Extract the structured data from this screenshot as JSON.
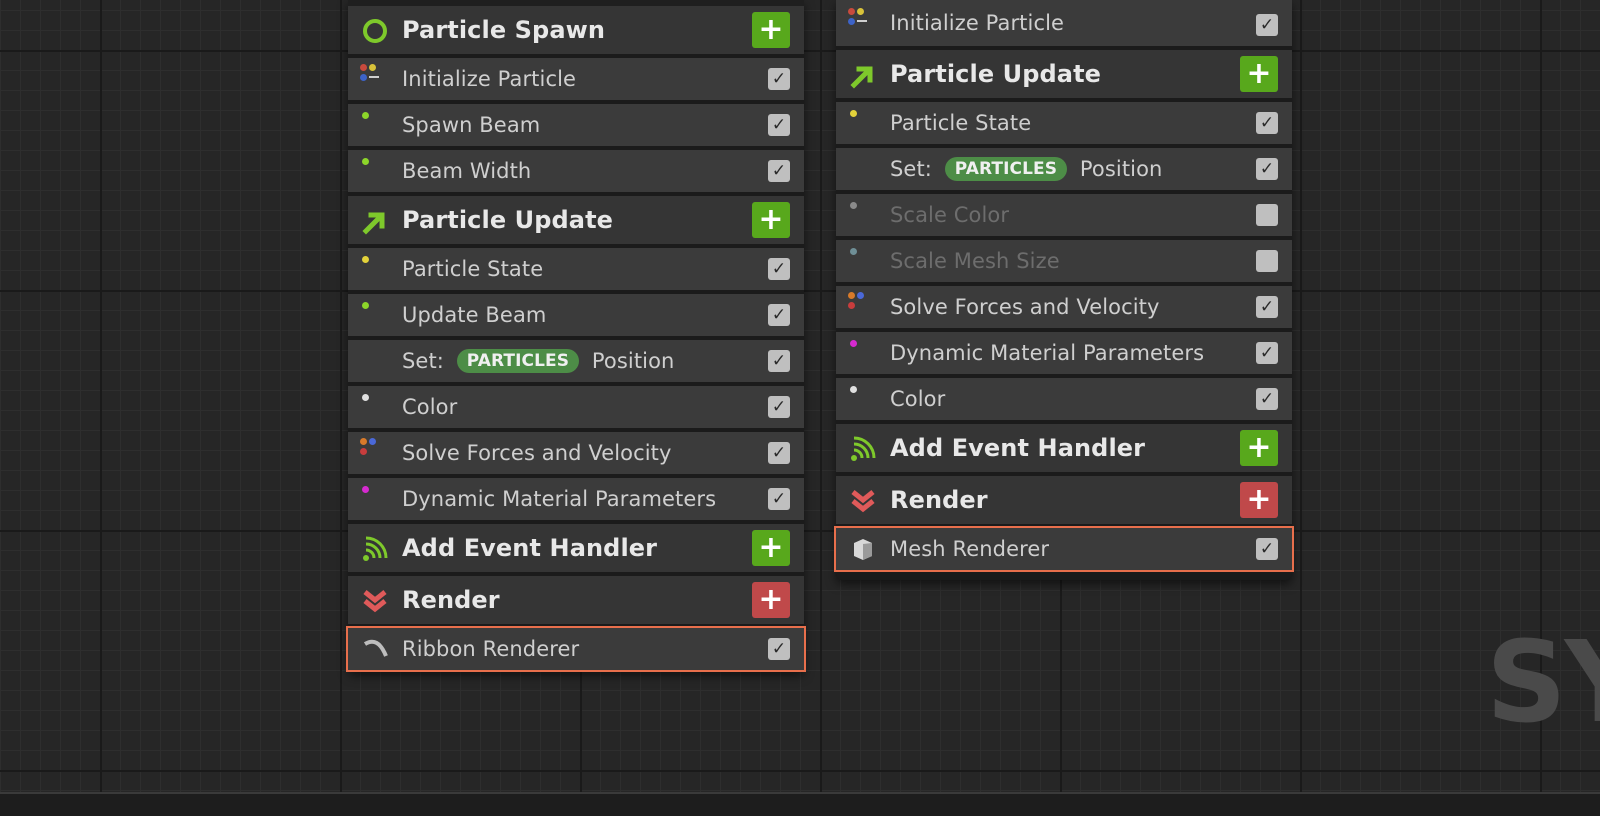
{
  "left_stack": {
    "spawn_header": "Particle Spawn",
    "spawn_items": [
      "Initialize Particle",
      "Spawn Beam",
      "Beam Width"
    ],
    "update_header": "Particle Update",
    "update_items": [
      "Particle State",
      "Update Beam",
      "Color",
      "Solve Forces and Velocity",
      "Dynamic Material Parameters"
    ],
    "set_prefix": "Set:",
    "set_pill": "PARTICLES",
    "set_suffix": "Position",
    "event_header": "Add Event Handler",
    "render_header": "Render",
    "renderer": "Ribbon Renderer"
  },
  "right_stack": {
    "init_item": "Initialize Particle",
    "update_header": "Particle Update",
    "items": [
      "Particle State",
      "Scale Color",
      "Scale Mesh Size",
      "Solve Forces and Velocity",
      "Dynamic Material Parameters",
      "Color"
    ],
    "set_prefix": "Set:",
    "set_pill": "PARTICLES",
    "set_suffix": "Position",
    "event_header": "Add Event Handler",
    "render_header": "Render",
    "renderer": "Mesh Renderer"
  },
  "watermark": "SY",
  "colors": {
    "accent_green": "#58a81c",
    "accent_red": "#c0494a",
    "highlight": "#e86f4c",
    "pill": "#4d8d47"
  },
  "icons": {
    "check": "✓",
    "plus": "+"
  }
}
